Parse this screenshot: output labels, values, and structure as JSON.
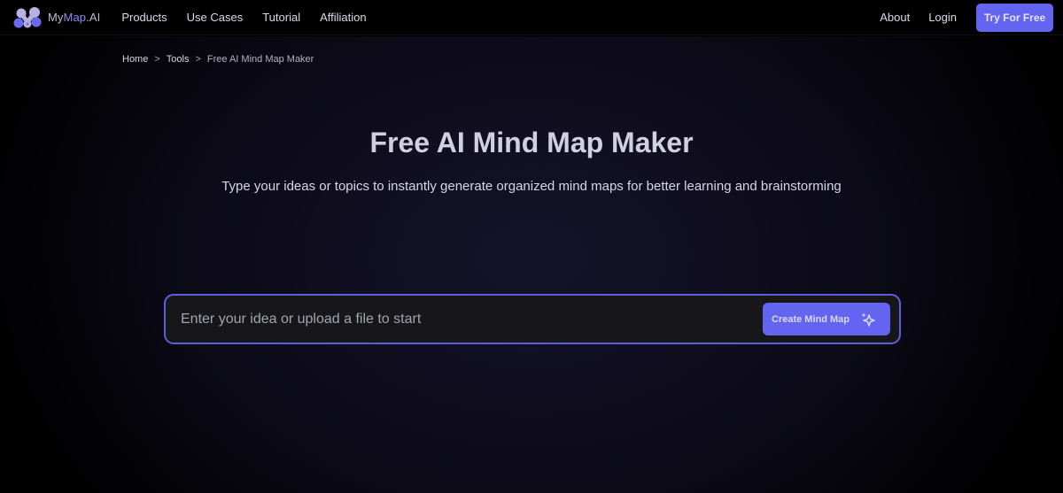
{
  "navbar": {
    "logo": {
      "text_prefix": "My",
      "text_accent": "Map",
      "text_suffix": ".AI",
      "icon": "mymap-logo-icon"
    },
    "links": [
      "Products",
      "Use Cases",
      "Tutorial",
      "Affiliation"
    ],
    "right_links": [
      "About",
      "Login"
    ],
    "cta_label": "Try For Free"
  },
  "breadcrumb": {
    "items": [
      "Home",
      "Tools",
      "Free AI Mind Map Maker"
    ],
    "separator": ">"
  },
  "hero": {
    "title": "Free AI Mind Map Maker",
    "subtitle": "Type your ideas or topics to instantly generate organized mind maps for better learning and brainstorming"
  },
  "input": {
    "value": "",
    "placeholder": "Enter your idea or upload a file to start",
    "button_label": "Create Mind Map",
    "button_icon": "sparkle-icon"
  },
  "colors": {
    "accent": "#6365f1",
    "input_border": "#5e5ed9",
    "background": "#000000"
  }
}
